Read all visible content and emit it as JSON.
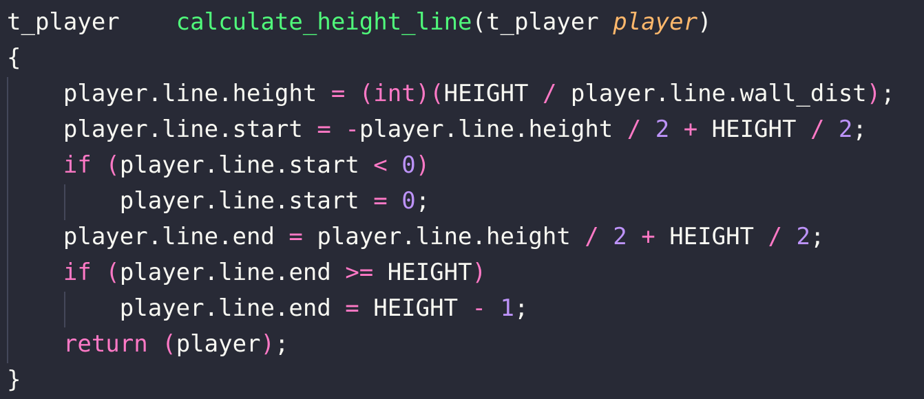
{
  "colors": {
    "background": "#282a36",
    "foreground": "#f8f8f2",
    "keyword": "#ff79c6",
    "function": "#50fa7b",
    "parameter": "#ffb86c",
    "number": "#bd93f9",
    "indent_guide": "#44475a"
  },
  "code": {
    "l1": {
      "ret_type": "t_player",
      "func_name": "calculate_height_line",
      "open_paren": "(",
      "param_type": "t_player ",
      "param_name": "player",
      "close_paren": ")"
    },
    "l2": {
      "brace": "{"
    },
    "l3": {
      "lhs": "player.line.height ",
      "eq": "=",
      "sp": " ",
      "cast": "(int)",
      "p1": "(",
      "height": "HEIGHT ",
      "div": "/",
      "rhs": " player.line.wall_dist",
      "p2": ")",
      "semi": ";"
    },
    "l4": {
      "lhs": "player.line.start ",
      "eq": "=",
      "sp": " ",
      "neg": "-",
      "mid": "player.line.height ",
      "div1": "/",
      "sp2": " ",
      "n1": "2",
      "sp3": " ",
      "plus": "+",
      "height": " HEIGHT ",
      "div2": "/",
      "sp4": " ",
      "n2": "2",
      "semi": ";"
    },
    "l5": {
      "kw": "if",
      "sp": " ",
      "p1": "(",
      "cond": "player.line.start ",
      "lt": "<",
      "sp2": " ",
      "n": "0",
      "p2": ")"
    },
    "l6": {
      "lhs": "player.line.start ",
      "eq": "=",
      "sp": " ",
      "n": "0",
      "semi": ";"
    },
    "l7": {
      "lhs": "player.line.end ",
      "eq": "=",
      "mid": " player.line.height ",
      "div1": "/",
      "sp2": " ",
      "n1": "2",
      "sp3": " ",
      "plus": "+",
      "height": " HEIGHT ",
      "div2": "/",
      "sp4": " ",
      "n2": "2",
      "semi": ";"
    },
    "l8": {
      "kw": "if",
      "sp": " ",
      "p1": "(",
      "cond": "player.line.end ",
      "ge": ">=",
      "height": " HEIGHT",
      "p2": ")"
    },
    "l9": {
      "lhs": "player.line.end ",
      "eq": "=",
      "height": " HEIGHT ",
      "minus": "-",
      "sp": " ",
      "n": "1",
      "semi": ";"
    },
    "l10": {
      "kw": "return",
      "sp": " ",
      "p1": "(",
      "val": "player",
      "p2": ")",
      "semi": ";"
    },
    "l11": {
      "brace": "}"
    }
  }
}
